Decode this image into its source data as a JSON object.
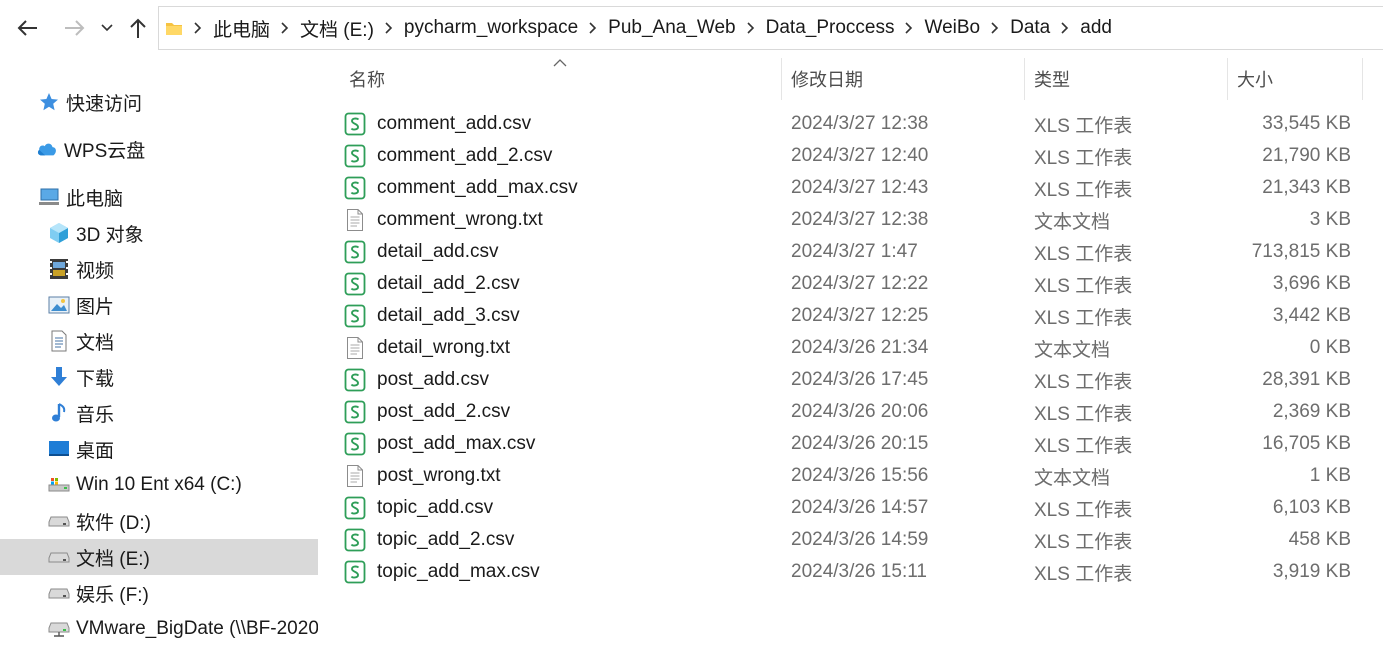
{
  "address_bar": {
    "crumbs": [
      "此电脑",
      "文档 (E:)",
      "pycharm_workspace",
      "Pub_Ana_Web",
      "Data_Proccess",
      "WeiBo",
      "Data",
      "add"
    ]
  },
  "nav": {
    "items": [
      {
        "label": "快速访问",
        "icon": "star-icon"
      },
      {
        "label": "WPS云盘",
        "icon": "cloud-icon"
      },
      {
        "label": "此电脑",
        "icon": "computer-icon"
      },
      {
        "label": "3D 对象",
        "icon": "cube-icon"
      },
      {
        "label": "视频",
        "icon": "video-icon"
      },
      {
        "label": "图片",
        "icon": "picture-icon"
      },
      {
        "label": "文档",
        "icon": "document-icon"
      },
      {
        "label": "下载",
        "icon": "download-icon"
      },
      {
        "label": "音乐",
        "icon": "music-icon"
      },
      {
        "label": "桌面",
        "icon": "desktop-icon"
      },
      {
        "label": "Win 10 Ent x64 (C:)",
        "icon": "system-drive-icon"
      },
      {
        "label": "软件 (D:)",
        "icon": "drive-icon"
      },
      {
        "label": "文档 (E:)",
        "icon": "drive-icon",
        "selected": true
      },
      {
        "label": "娱乐 (F:)",
        "icon": "drive-icon"
      },
      {
        "label": "VMware_BigDate (\\\\BF-2020",
        "icon": "network-drive-icon"
      }
    ]
  },
  "columns": {
    "name": "名称",
    "date": "修改日期",
    "type": "类型",
    "size": "大小"
  },
  "files": [
    {
      "name": "comment_add.csv",
      "date": "2024/3/27 12:38",
      "type": "XLS 工作表",
      "size": "33,545 KB",
      "icon": "spreadsheet-icon"
    },
    {
      "name": "comment_add_2.csv",
      "date": "2024/3/27 12:40",
      "type": "XLS 工作表",
      "size": "21,790 KB",
      "icon": "spreadsheet-icon"
    },
    {
      "name": "comment_add_max.csv",
      "date": "2024/3/27 12:43",
      "type": "XLS 工作表",
      "size": "21,343 KB",
      "icon": "spreadsheet-icon"
    },
    {
      "name": "comment_wrong.txt",
      "date": "2024/3/27 12:38",
      "type": "文本文档",
      "size": "3 KB",
      "icon": "text-file-icon"
    },
    {
      "name": "detail_add.csv",
      "date": "2024/3/27 1:47",
      "type": "XLS 工作表",
      "size": "713,815 KB",
      "icon": "spreadsheet-icon"
    },
    {
      "name": "detail_add_2.csv",
      "date": "2024/3/27 12:22",
      "type": "XLS 工作表",
      "size": "3,696 KB",
      "icon": "spreadsheet-icon"
    },
    {
      "name": "detail_add_3.csv",
      "date": "2024/3/27 12:25",
      "type": "XLS 工作表",
      "size": "3,442 KB",
      "icon": "spreadsheet-icon"
    },
    {
      "name": "detail_wrong.txt",
      "date": "2024/3/26 21:34",
      "type": "文本文档",
      "size": "0 KB",
      "icon": "text-file-icon"
    },
    {
      "name": "post_add.csv",
      "date": "2024/3/26 17:45",
      "type": "XLS 工作表",
      "size": "28,391 KB",
      "icon": "spreadsheet-icon"
    },
    {
      "name": "post_add_2.csv",
      "date": "2024/3/26 20:06",
      "type": "XLS 工作表",
      "size": "2,369 KB",
      "icon": "spreadsheet-icon"
    },
    {
      "name": "post_add_max.csv",
      "date": "2024/3/26 20:15",
      "type": "XLS 工作表",
      "size": "16,705 KB",
      "icon": "spreadsheet-icon"
    },
    {
      "name": "post_wrong.txt",
      "date": "2024/3/26 15:56",
      "type": "文本文档",
      "size": "1 KB",
      "icon": "text-file-icon"
    },
    {
      "name": "topic_add.csv",
      "date": "2024/3/26 14:57",
      "type": "XLS 工作表",
      "size": "6,103 KB",
      "icon": "spreadsheet-icon"
    },
    {
      "name": "topic_add_2.csv",
      "date": "2024/3/26 14:59",
      "type": "XLS 工作表",
      "size": "458 KB",
      "icon": "spreadsheet-icon"
    },
    {
      "name": "topic_add_max.csv",
      "date": "2024/3/26 15:11",
      "type": "XLS 工作表",
      "size": "3,919 KB",
      "icon": "spreadsheet-icon"
    }
  ],
  "colors": {
    "selected_nav": "#d9d9d9",
    "spreadsheet_green": "#2e9e58",
    "secondary_text": "#6d6d6d"
  }
}
